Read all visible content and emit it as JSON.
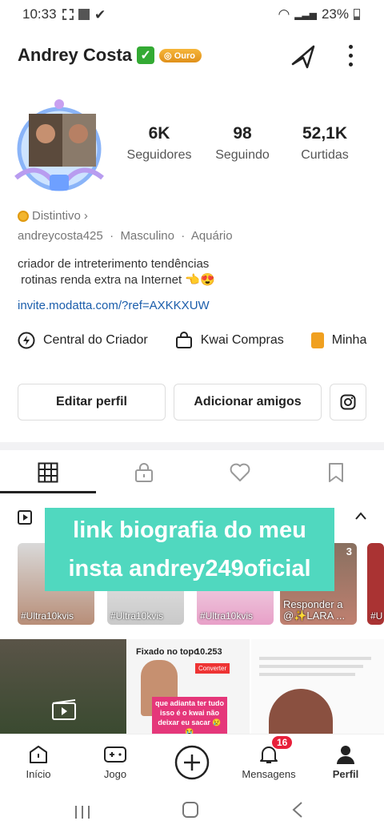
{
  "status": {
    "time": "10:33",
    "battery": "23%"
  },
  "profile": {
    "name": "Andrey Costa",
    "badge": "Ouro",
    "handle": "andreycosta425",
    "gender": "Masculino",
    "sign": "Aquário",
    "distintivo": "Distintivo",
    "bio": "criador de intreterimento tendências\n rotinas renda extra na Internet 👈😍",
    "link": "invite.modatta.com/?ref=AXKKXUW"
  },
  "stats": [
    {
      "value": "6K",
      "label": "Seguidores"
    },
    {
      "value": "98",
      "label": "Seguindo"
    },
    {
      "value": "52,1K",
      "label": "Curtidas"
    }
  ],
  "tools": [
    "Central do Criador",
    "Kwai Compras",
    "Minha"
  ],
  "buttons": {
    "edit": "Editar perfil",
    "add": "Adicionar amigos"
  },
  "thumbs": [
    {
      "caption": "#Ultra10kvis"
    },
    {
      "caption": "#Ultra10kvis"
    },
    {
      "caption": "#Ultra10kvis"
    },
    {
      "caption": "Responder a @✨LARA ...",
      "count": "3"
    },
    {
      "caption": "#U"
    }
  ],
  "overlay": "link biografia do meu\ninsta andrey249oficial",
  "posts": {
    "pinned": "Fixado no topo",
    "pinned_count": "10.253",
    "convert": "Converter",
    "caption": "que adianta ter tudo isso é o kwai não deixar eu sacar 😢😭"
  },
  "nav": {
    "inicio": "Início",
    "jogo": "Jogo",
    "mensagens": "Mensagens",
    "perfil": "Perfil",
    "badge": "16"
  }
}
